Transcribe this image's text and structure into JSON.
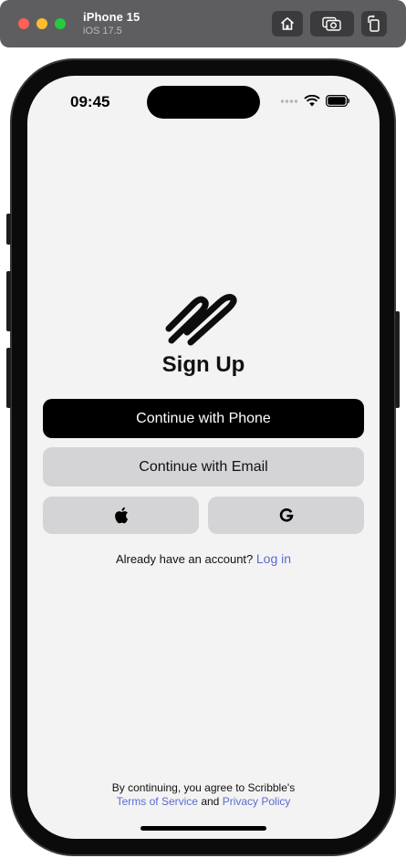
{
  "simulator": {
    "device_name": "iPhone 15",
    "os_version": "iOS 17.5",
    "buttons": [
      {
        "icon": "home-icon"
      },
      {
        "icon": "screenshot-icon"
      },
      {
        "icon": "rotate-icon"
      }
    ]
  },
  "status_bar": {
    "time": "09:45",
    "icons": [
      "cellular-icon",
      "wifi-icon",
      "battery-icon"
    ]
  },
  "signup": {
    "logo_icon": "scribble-logo-icon",
    "title": "Sign Up",
    "phone_button": "Continue with Phone",
    "email_button": "Continue with Email",
    "social_buttons": [
      {
        "icon": "apple-icon"
      },
      {
        "icon": "google-icon"
      }
    ],
    "login_prompt": "Already have an account?",
    "login_link": "Log in"
  },
  "legal": {
    "prefix": "By continuing, you agree to Scribble's",
    "terms_link": "Terms of Service",
    "conjunction": "and",
    "privacy_link": "Privacy Policy"
  },
  "colors": {
    "link": "#5a6bcf",
    "primary_button": "#000000",
    "secondary_button": "#d4d4d6",
    "screen_background": "#f3f3f4"
  }
}
